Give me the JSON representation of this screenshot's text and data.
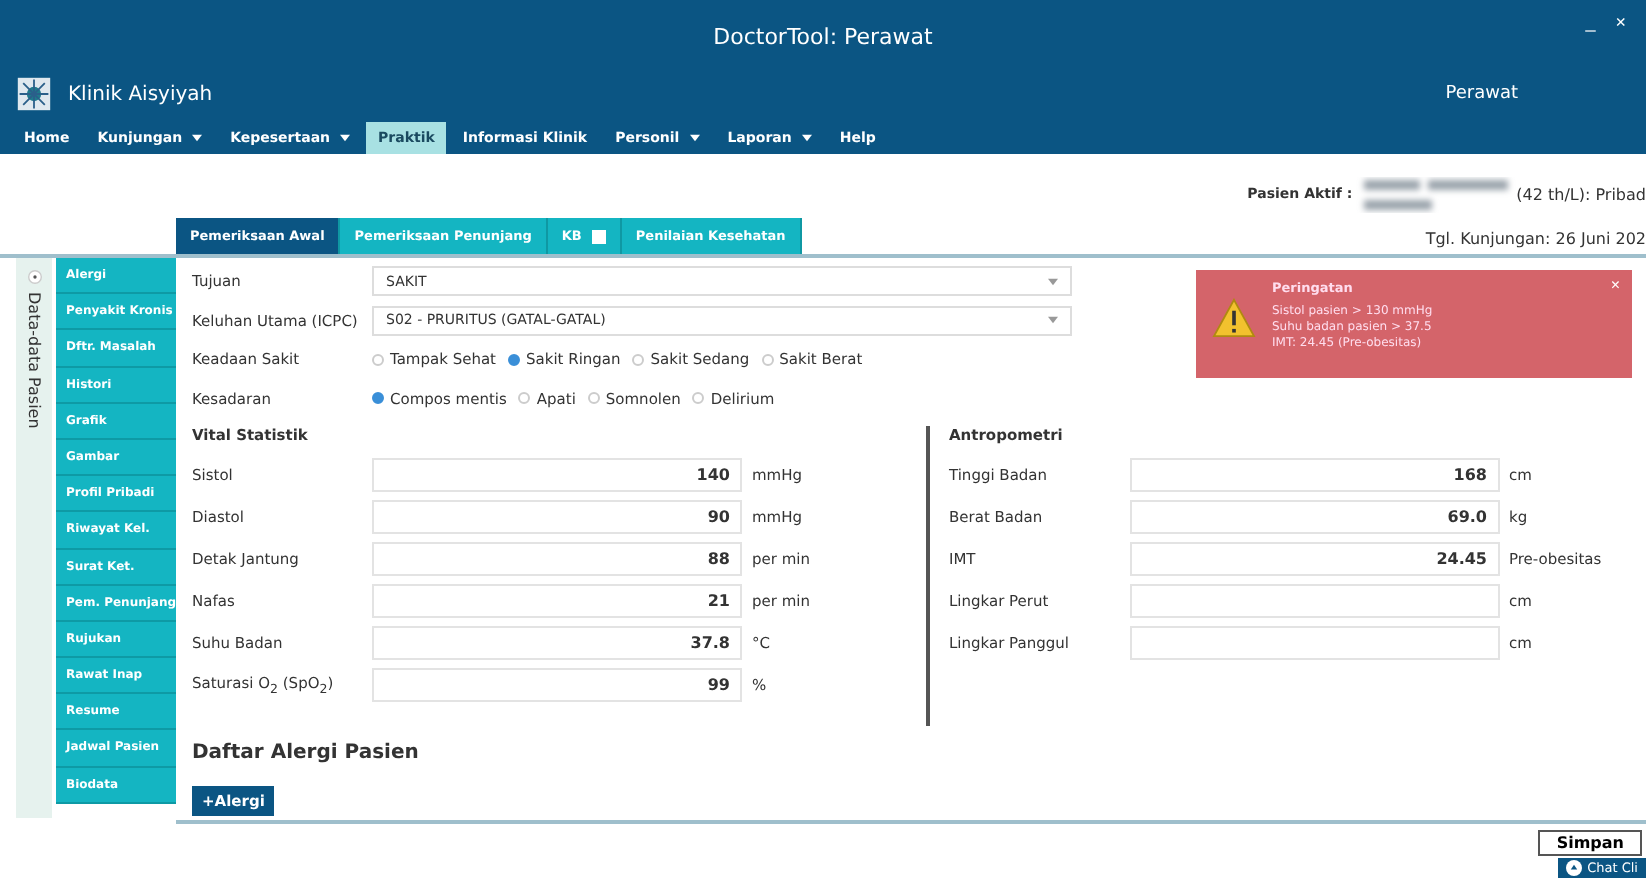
{
  "window": {
    "title": "DoctorTool: Perawat",
    "controls": [
      "_",
      "×"
    ]
  },
  "app": {
    "name": "Klinik Aisyiyah",
    "user": "Perawat"
  },
  "menu": [
    {
      "label": "Home",
      "dropdown": false,
      "selected": false
    },
    {
      "label": "Kunjungan",
      "dropdown": true,
      "selected": false
    },
    {
      "label": "Kepesertaan",
      "dropdown": true,
      "selected": false
    },
    {
      "label": "Praktik",
      "dropdown": false,
      "selected": true
    },
    {
      "label": "Informasi Klinik",
      "dropdown": false,
      "selected": false
    },
    {
      "label": "Personil",
      "dropdown": true,
      "selected": false
    },
    {
      "label": "Laporan",
      "dropdown": true,
      "selected": false
    },
    {
      "label": "Help",
      "dropdown": false,
      "selected": false
    }
  ],
  "patient": {
    "label": "Pasien Aktif :",
    "info": "(42 th/L): Pribad",
    "visit": "Tgl. Kunjungan: 26 Juni 202"
  },
  "side_panel": {
    "title": "Data-data Pasien",
    "items": [
      "Alergi",
      "Penyakit Kronis",
      "Dftr. Masalah",
      "Histori",
      "Grafik",
      "Gambar",
      "Profil Pribadi",
      "Riwayat Kel.",
      "Surat Ket.",
      "Pem. Penunjang",
      "Rujukan",
      "Rawat Inap",
      "Resume",
      "Jadwal Pasien",
      "Biodata"
    ]
  },
  "tabs": [
    {
      "kind": "plain",
      "label": "Pemeriksaan Awal",
      "selected": true
    },
    {
      "kind": "plain",
      "label": "Pemeriksaan Penunjang",
      "selected": false
    },
    {
      "kind": "checkbox",
      "label": "KB",
      "selected": false,
      "checked": false
    },
    {
      "kind": "plain",
      "label": "Penilaian Kesehatan",
      "selected": false
    }
  ],
  "selects": [
    {
      "label": "Tujuan",
      "value": "SAKIT"
    },
    {
      "label": "Keluhan Utama (ICPC)",
      "value": "S02 - PRURITUS (GATAL-GATAL)"
    }
  ],
  "radio_groups": [
    {
      "label": "Keadaan Sakit",
      "options": [
        {
          "label": "Tampak Sehat",
          "selected": false
        },
        {
          "label": "Sakit Ringan",
          "selected": true
        },
        {
          "label": "Sakit Sedang",
          "selected": false
        },
        {
          "label": "Sakit Berat",
          "selected": false
        }
      ]
    },
    {
      "label": "Kesadaran",
      "options": [
        {
          "label": "Compos mentis",
          "selected": true
        },
        {
          "label": "Apati",
          "selected": false
        },
        {
          "label": "Somnolen",
          "selected": false
        },
        {
          "label": "Delirium",
          "selected": false
        }
      ]
    }
  ],
  "vital": {
    "title": "Vital Statistik",
    "rows": [
      {
        "label": "Sistol",
        "value": "140",
        "unit": "mmHg"
      },
      {
        "label": "Diastol",
        "value": "90",
        "unit": "mmHg"
      },
      {
        "label": "Detak Jantung",
        "value": "88",
        "unit": "per min"
      },
      {
        "label": "Nafas",
        "value": "21",
        "unit": "per min"
      },
      {
        "label": "Suhu Badan",
        "value": "37.8",
        "unit": "°C"
      },
      {
        "label": "Saturasi O$_{2}$ (SpO$_{2}$)",
        "value": "99",
        "unit": "%"
      }
    ]
  },
  "antropometri": {
    "title": "Antropometri",
    "rows": [
      {
        "label": "Tinggi Badan",
        "value": "168",
        "unit": "cm"
      },
      {
        "label": "Berat Badan",
        "value": "69.0",
        "unit": "kg"
      },
      {
        "label": "IMT",
        "value": "24.45",
        "unit": "Pre-obesitas"
      },
      {
        "label": "Lingkar Perut",
        "unit": "cm"
      },
      {
        "label": "Lingkar Panggul",
        "unit": "cm"
      }
    ]
  },
  "alert": {
    "title": "Peringatan",
    "close": "×",
    "lines": [
      "Sistol pasien > 130 mmHg",
      "Suhu badan pasien > 37.5",
      "IMT: 24.45 (Pre-obesitas)"
    ]
  },
  "allergy": {
    "title": "Daftar Alergi Pasien",
    "button": "+Alergi"
  },
  "footer": {
    "save": "Simpan",
    "chat": "Chat Cli"
  }
}
